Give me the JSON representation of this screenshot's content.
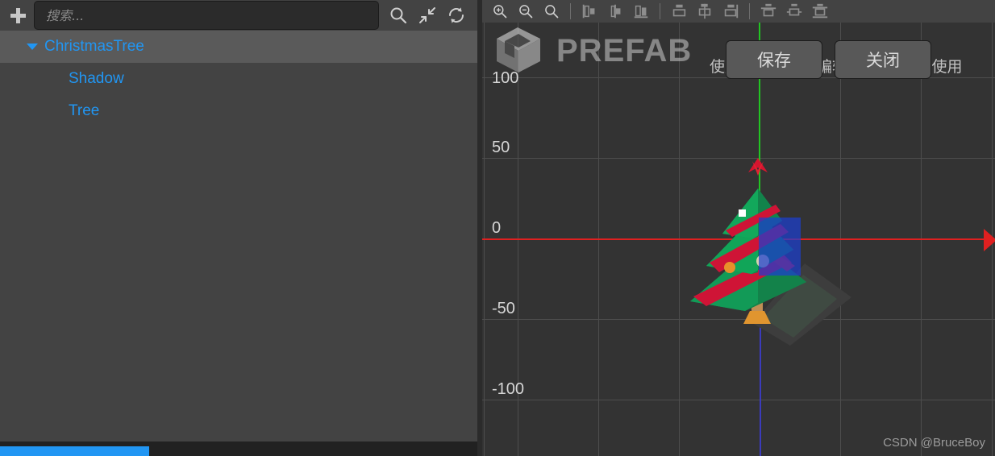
{
  "left_panel": {
    "add_button": "add-node-button",
    "search": {
      "placeholder": "搜索...",
      "value": ""
    },
    "toolbar_icons": [
      {
        "name": "search-icon",
        "label": "搜索"
      },
      {
        "name": "collapse-all-icon",
        "label": "折叠全部"
      },
      {
        "name": "refresh-icon",
        "label": "刷新"
      }
    ],
    "tree": [
      {
        "label": "ChristmasTree",
        "depth": 0,
        "expanded": true,
        "selected": true
      },
      {
        "label": "Shadow",
        "depth": 1,
        "expanded": false,
        "selected": false
      },
      {
        "label": "Tree",
        "depth": 1,
        "expanded": false,
        "selected": false
      }
    ],
    "scrollbar": {
      "name": "horizontal-scrollbar",
      "color": "#2196f3"
    }
  },
  "viewport": {
    "toolbar": [
      {
        "name": "zoom-in-icon",
        "label": "放大"
      },
      {
        "name": "zoom-out-icon",
        "label": "缩小"
      },
      {
        "name": "zoom-reset-icon",
        "label": "重置缩放"
      },
      {
        "name": "align-left-icon",
        "label": "左对齐"
      },
      {
        "name": "align-center-horizontal-icon",
        "label": "水平居中对齐"
      },
      {
        "name": "align-right-icon",
        "label": "右对齐"
      },
      {
        "name": "align-top-icon",
        "label": "顶对齐"
      },
      {
        "name": "align-center-vertical-icon",
        "label": "垂直居中对齐"
      },
      {
        "name": "align-bottom-icon",
        "label": "底对齐"
      },
      {
        "name": "distribute-top-icon",
        "label": "顶部分布"
      },
      {
        "name": "distribute-center-icon",
        "label": "居中分布"
      },
      {
        "name": "distribute-bottom-icon",
        "label": "底部分布"
      }
    ],
    "prefab_label": "PREFAB",
    "banner_text": "使用更多标志在编辑移动变化。，使用",
    "buttons": {
      "save": "保存",
      "close": "关闭"
    },
    "ruler_labels": [
      "100",
      "50",
      "0",
      "-50",
      "-100"
    ],
    "axes": {
      "x_color": "#e02020",
      "y_color": "#22c522",
      "z_color": "#3b3bbb"
    },
    "model": {
      "name": "christmas-tree",
      "foliage_color": "#0f9e52",
      "stripe_color": "#d8163a",
      "trunk_color": "#c79256",
      "star_color": "#e01020",
      "bauble_colors": [
        "#ffffff",
        "#e8902a",
        "#d9d2b0"
      ]
    },
    "watermark": "CSDN @BruceBoy"
  }
}
